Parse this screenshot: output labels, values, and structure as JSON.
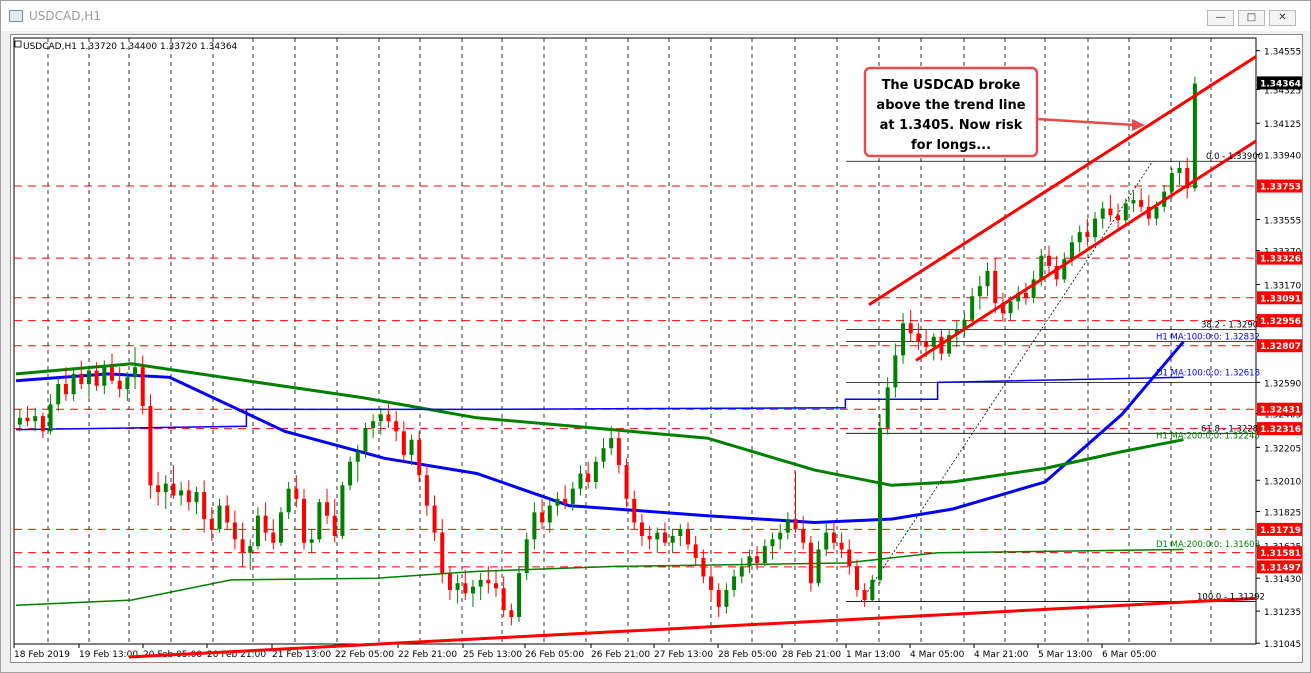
{
  "window": {
    "title": "USDCAD,H1"
  },
  "window_buttons": {
    "minimize": "—",
    "maximize": "□",
    "close": "✕"
  },
  "chart_data": {
    "type": "candlestick",
    "symbol_info": "USDCAD,H1  1.33720 1.34400 1.33720 1.34364",
    "ylim": [
      1.3104,
      1.3463
    ],
    "y_ticks": [
      "1.34555",
      "1.34325",
      "1.34125",
      "1.33940",
      "1.33555",
      "1.33370",
      "1.33170",
      "1.32975",
      "1.32590",
      "1.32405",
      "1.32205",
      "1.32010",
      "1.31825",
      "1.31625",
      "1.31430",
      "1.31235",
      "1.31045"
    ],
    "x_ticks": [
      "18 Feb 2019",
      "19 Feb 13:00",
      "20 Feb 05:00",
      "20 Feb 21:00",
      "21 Feb 13:00",
      "22 Feb 05:00",
      "22 Feb 21:00",
      "25 Feb 13:00",
      "26 Feb 05:00",
      "26 Feb 21:00",
      "27 Feb 13:00",
      "28 Feb 05:00",
      "28 Feb 21:00",
      "1 Mar 13:00",
      "4 Mar 05:00",
      "4 Mar 21:00",
      "5 Mar 13:00",
      "6 Mar 05:00"
    ],
    "price_labels": [
      {
        "value": "1.34364",
        "color": "#000000"
      },
      {
        "value": "1.33753",
        "color": "#ff0000"
      },
      {
        "value": "1.33326",
        "color": "#ff0000"
      },
      {
        "value": "1.33091",
        "color": "#ff0000"
      },
      {
        "value": "1.32956",
        "color": "#ff0000"
      },
      {
        "value": "1.32807",
        "color": "#ff0000"
      },
      {
        "value": "1.32431",
        "color": "#ff0000"
      },
      {
        "value": "1.32316",
        "color": "#ff0000"
      },
      {
        "value": "1.31719",
        "color": "#ff0000"
      },
      {
        "value": "1.31581",
        "color": "#ff0000"
      },
      {
        "value": "1.31497",
        "color": "#ff0000"
      }
    ],
    "level_labels": [
      "0.0 - 1.33900",
      "38.2 - 1.32904",
      "H1 MA:100:0:0: 1.32832",
      "D1 MA:100:0:0: 1.32618",
      "61.8 - 1.32288",
      "H1 MA:200:0:0: 1.32245",
      "D1 MA:200:0:0: 1.31603",
      "100.0 - 1.31292"
    ],
    "annotation": [
      "The USDCAD broke",
      "above the trend line",
      "at 1.3405. Now risk",
      "for longs..."
    ],
    "candles": [
      [
        1.3234,
        1.3243,
        1.323,
        1.3238
      ],
      [
        1.3238,
        1.3245,
        1.3233,
        1.3236
      ],
      [
        1.3236,
        1.3244,
        1.323,
        1.3239
      ],
      [
        1.3239,
        1.3241,
        1.3226,
        1.323
      ],
      [
        1.323,
        1.3252,
        1.3228,
        1.3246
      ],
      [
        1.3246,
        1.3262,
        1.3242,
        1.3258
      ],
      [
        1.3258,
        1.3268,
        1.3248,
        1.3252
      ],
      [
        1.3252,
        1.3266,
        1.3248,
        1.3264
      ],
      [
        1.3264,
        1.3272,
        1.3255,
        1.3258
      ],
      [
        1.3258,
        1.3269,
        1.325,
        1.3266
      ],
      [
        1.3266,
        1.3271,
        1.3254,
        1.3257
      ],
      [
        1.3257,
        1.3272,
        1.3252,
        1.3268
      ],
      [
        1.3268,
        1.3276,
        1.3258,
        1.326
      ],
      [
        1.326,
        1.3268,
        1.325,
        1.3255
      ],
      [
        1.3255,
        1.3265,
        1.3248,
        1.3262
      ],
      [
        1.3262,
        1.328,
        1.3255,
        1.3268
      ],
      [
        1.3268,
        1.3275,
        1.324,
        1.3245
      ],
      [
        1.3245,
        1.3252,
        1.319,
        1.3198
      ],
      [
        1.3198,
        1.3206,
        1.3186,
        1.3194
      ],
      [
        1.3194,
        1.3204,
        1.3184,
        1.3199
      ],
      [
        1.3199,
        1.321,
        1.319,
        1.3192
      ],
      [
        1.3192,
        1.32,
        1.3186,
        1.3195
      ],
      [
        1.3195,
        1.3201,
        1.3183,
        1.3188
      ],
      [
        1.3188,
        1.3197,
        1.3181,
        1.3194
      ],
      [
        1.3194,
        1.3201,
        1.317,
        1.3178
      ],
      [
        1.3178,
        1.3185,
        1.3165,
        1.3172
      ],
      [
        1.3172,
        1.319,
        1.317,
        1.3186
      ],
      [
        1.3186,
        1.3192,
        1.3172,
        1.3176
      ],
      [
        1.3176,
        1.3183,
        1.316,
        1.3166
      ],
      [
        1.3166,
        1.3176,
        1.315,
        1.3158
      ],
      [
        1.3158,
        1.3166,
        1.3148,
        1.3162
      ],
      [
        1.3162,
        1.3185,
        1.316,
        1.318
      ],
      [
        1.318,
        1.3188,
        1.3165,
        1.317
      ],
      [
        1.317,
        1.3178,
        1.316,
        1.3164
      ],
      [
        1.3164,
        1.3185,
        1.3162,
        1.3182
      ],
      [
        1.3182,
        1.32,
        1.3178,
        1.3196
      ],
      [
        1.3196,
        1.3204,
        1.3185,
        1.319
      ],
      [
        1.319,
        1.3196,
        1.316,
        1.3164
      ],
      [
        1.3164,
        1.3172,
        1.3158,
        1.3166
      ],
      [
        1.3166,
        1.319,
        1.3164,
        1.3188
      ],
      [
        1.3188,
        1.3196,
        1.3175,
        1.318
      ],
      [
        1.318,
        1.319,
        1.3164,
        1.3168
      ],
      [
        1.3168,
        1.32,
        1.3166,
        1.3198
      ],
      [
        1.3198,
        1.3215,
        1.3195,
        1.3212
      ],
      [
        1.3212,
        1.3222,
        1.32,
        1.3218
      ],
      [
        1.3218,
        1.3235,
        1.3214,
        1.3232
      ],
      [
        1.3232,
        1.324,
        1.3226,
        1.3236
      ],
      [
        1.3236,
        1.3244,
        1.3228,
        1.324
      ],
      [
        1.324,
        1.3246,
        1.3232,
        1.3236
      ],
      [
        1.3236,
        1.3242,
        1.3224,
        1.323
      ],
      [
        1.323,
        1.3236,
        1.3212,
        1.3216
      ],
      [
        1.3216,
        1.3228,
        1.321,
        1.3225
      ],
      [
        1.3225,
        1.323,
        1.32,
        1.3204
      ],
      [
        1.3204,
        1.321,
        1.318,
        1.3186
      ],
      [
        1.3186,
        1.3192,
        1.3165,
        1.317
      ],
      [
        1.317,
        1.3178,
        1.314,
        1.3146
      ],
      [
        1.3146,
        1.315,
        1.313,
        1.3136
      ],
      [
        1.3136,
        1.3145,
        1.3128,
        1.314
      ],
      [
        1.314,
        1.3148,
        1.313,
        1.3134
      ],
      [
        1.3134,
        1.3142,
        1.3126,
        1.3138
      ],
      [
        1.3138,
        1.3146,
        1.313,
        1.3142
      ],
      [
        1.3142,
        1.315,
        1.3134,
        1.314
      ],
      [
        1.314,
        1.3148,
        1.3132,
        1.3137
      ],
      [
        1.3137,
        1.3144,
        1.312,
        1.3124
      ],
      [
        1.3124,
        1.3128,
        1.3115,
        1.312
      ],
      [
        1.312,
        1.315,
        1.3117,
        1.3146
      ],
      [
        1.3146,
        1.317,
        1.3142,
        1.3166
      ],
      [
        1.3166,
        1.3188,
        1.316,
        1.3182
      ],
      [
        1.3182,
        1.319,
        1.3172,
        1.3176
      ],
      [
        1.3176,
        1.319,
        1.317,
        1.3186
      ],
      [
        1.3186,
        1.3194,
        1.318,
        1.319
      ],
      [
        1.319,
        1.3198,
        1.3184,
        1.3187
      ],
      [
        1.3187,
        1.32,
        1.3183,
        1.3196
      ],
      [
        1.3196,
        1.321,
        1.3192,
        1.3205
      ],
      [
        1.3205,
        1.3212,
        1.3196,
        1.32
      ],
      [
        1.32,
        1.3215,
        1.3196,
        1.3212
      ],
      [
        1.3212,
        1.3226,
        1.3208,
        1.322
      ],
      [
        1.322,
        1.3233,
        1.3216,
        1.3226
      ],
      [
        1.3226,
        1.323,
        1.3205,
        1.321
      ],
      [
        1.321,
        1.3214,
        1.3185,
        1.319
      ],
      [
        1.319,
        1.3195,
        1.3172,
        1.3176
      ],
      [
        1.3176,
        1.3181,
        1.3162,
        1.3168
      ],
      [
        1.3168,
        1.3174,
        1.316,
        1.3166
      ],
      [
        1.3166,
        1.3173,
        1.3158,
        1.317
      ],
      [
        1.317,
        1.3176,
        1.3162,
        1.3164
      ],
      [
        1.3164,
        1.3172,
        1.3158,
        1.3168
      ],
      [
        1.3168,
        1.3175,
        1.3162,
        1.3172
      ],
      [
        1.3172,
        1.3176,
        1.316,
        1.3163
      ],
      [
        1.3163,
        1.3168,
        1.315,
        1.3155
      ],
      [
        1.3155,
        1.316,
        1.314,
        1.3144
      ],
      [
        1.3144,
        1.315,
        1.313,
        1.3136
      ],
      [
        1.3136,
        1.314,
        1.312,
        1.3126
      ],
      [
        1.3126,
        1.314,
        1.3122,
        1.3136
      ],
      [
        1.3136,
        1.3148,
        1.3132,
        1.3144
      ],
      [
        1.3144,
        1.3155,
        1.314,
        1.315
      ],
      [
        1.315,
        1.316,
        1.3146,
        1.3156
      ],
      [
        1.3156,
        1.3162,
        1.3148,
        1.3152
      ],
      [
        1.3152,
        1.3166,
        1.315,
        1.3162
      ],
      [
        1.3162,
        1.317,
        1.3154,
        1.3166
      ],
      [
        1.3166,
        1.3175,
        1.316,
        1.317
      ],
      [
        1.317,
        1.3182,
        1.3166,
        1.3178
      ],
      [
        1.3178,
        1.3206,
        1.317,
        1.3172
      ],
      [
        1.3172,
        1.318,
        1.316,
        1.3164
      ],
      [
        1.3164,
        1.3168,
        1.3135,
        1.314
      ],
      [
        1.314,
        1.3165,
        1.3138,
        1.316
      ],
      [
        1.316,
        1.3176,
        1.3156,
        1.317
      ],
      [
        1.317,
        1.3176,
        1.316,
        1.3164
      ],
      [
        1.3164,
        1.317,
        1.3155,
        1.316
      ],
      [
        1.316,
        1.3166,
        1.3145,
        1.315
      ],
      [
        1.315,
        1.3154,
        1.3132,
        1.3136
      ],
      [
        1.3136,
        1.314,
        1.3126,
        1.313
      ],
      [
        1.313,
        1.3145,
        1.3129,
        1.3142
      ],
      [
        1.3142,
        1.324,
        1.314,
        1.3232
      ],
      [
        1.3232,
        1.3262,
        1.3228,
        1.3256
      ],
      [
        1.3256,
        1.3282,
        1.325,
        1.3275
      ],
      [
        1.3275,
        1.33,
        1.327,
        1.3294
      ],
      [
        1.3294,
        1.3302,
        1.3283,
        1.3288
      ],
      [
        1.3288,
        1.3294,
        1.3278,
        1.3283
      ],
      [
        1.3283,
        1.329,
        1.3274,
        1.328
      ],
      [
        1.328,
        1.3288,
        1.3272,
        1.3286
      ],
      [
        1.3286,
        1.329,
        1.3272,
        1.3276
      ],
      [
        1.3276,
        1.329,
        1.3274,
        1.3287
      ],
      [
        1.3287,
        1.3296,
        1.328,
        1.329
      ],
      [
        1.329,
        1.33,
        1.3286,
        1.3296
      ],
      [
        1.3296,
        1.3315,
        1.3292,
        1.331
      ],
      [
        1.331,
        1.3322,
        1.3302,
        1.3316
      ],
      [
        1.3316,
        1.333,
        1.331,
        1.3325
      ],
      [
        1.3325,
        1.3333,
        1.33,
        1.3306
      ],
      [
        1.3306,
        1.3312,
        1.3295,
        1.33
      ],
      [
        1.33,
        1.331,
        1.3296,
        1.3307
      ],
      [
        1.3307,
        1.3316,
        1.3302,
        1.3312
      ],
      [
        1.3312,
        1.3318,
        1.3305,
        1.3309
      ],
      [
        1.3309,
        1.3325,
        1.3306,
        1.332
      ],
      [
        1.332,
        1.3338,
        1.3316,
        1.3334
      ],
      [
        1.3334,
        1.334,
        1.3322,
        1.3328
      ],
      [
        1.3328,
        1.3334,
        1.3316,
        1.332
      ],
      [
        1.332,
        1.3336,
        1.3318,
        1.3332
      ],
      [
        1.3332,
        1.3346,
        1.3328,
        1.3342
      ],
      [
        1.3342,
        1.3352,
        1.3336,
        1.3348
      ],
      [
        1.3348,
        1.3356,
        1.334,
        1.3345
      ],
      [
        1.3345,
        1.336,
        1.3342,
        1.3356
      ],
      [
        1.3356,
        1.3366,
        1.335,
        1.3362
      ],
      [
        1.3362,
        1.337,
        1.3354,
        1.3358
      ],
      [
        1.3358,
        1.3365,
        1.335,
        1.3355
      ],
      [
        1.3355,
        1.3368,
        1.3352,
        1.3365
      ],
      [
        1.3365,
        1.3372,
        1.336,
        1.3367
      ],
      [
        1.3367,
        1.3374,
        1.336,
        1.3363
      ],
      [
        1.3363,
        1.337,
        1.3352,
        1.3356
      ],
      [
        1.3356,
        1.3366,
        1.3352,
        1.3363
      ],
      [
        1.3363,
        1.3376,
        1.336,
        1.3372
      ],
      [
        1.3372,
        1.3386,
        1.3368,
        1.3383
      ],
      [
        1.3383,
        1.339,
        1.3376,
        1.3386
      ],
      [
        1.3386,
        1.3392,
        1.3368,
        1.3374
      ],
      [
        1.3374,
        1.344,
        1.3372,
        1.3436
      ]
    ],
    "indicators": [
      {
        "name": "H1 MA:100",
        "color": "#0000ff",
        "values": [
          [
            0,
            1.326
          ],
          [
            12,
            1.3264
          ],
          [
            20,
            1.3262
          ],
          [
            35,
            1.323
          ],
          [
            48,
            1.3214
          ],
          [
            60,
            1.3205
          ],
          [
            72,
            1.3186
          ],
          [
            90,
            1.318
          ],
          [
            104,
            1.3176
          ],
          [
            114,
            1.3178
          ],
          [
            122,
            1.3184
          ],
          [
            134,
            1.32
          ],
          [
            144,
            1.324
          ],
          [
            152,
            1.3283
          ]
        ]
      },
      {
        "name": "H1 MA:200",
        "color": "#008000",
        "values": [
          [
            0,
            1.3264
          ],
          [
            15,
            1.327
          ],
          [
            30,
            1.326
          ],
          [
            45,
            1.325
          ],
          [
            60,
            1.3238
          ],
          [
            75,
            1.3232
          ],
          [
            90,
            1.3226
          ],
          [
            104,
            1.3207
          ],
          [
            114,
            1.3198
          ],
          [
            122,
            1.32
          ],
          [
            134,
            1.3208
          ],
          [
            144,
            1.3218
          ],
          [
            152,
            1.3225
          ]
        ]
      },
      {
        "name": "D1 MA:100",
        "color": "#0000ff",
        "values": [
          [
            0,
            1.3231
          ],
          [
            30,
            1.3233
          ],
          [
            30,
            1.3243
          ],
          [
            60,
            1.3243
          ],
          [
            108,
            1.3244
          ],
          [
            108,
            1.3249
          ],
          [
            120,
            1.3249
          ],
          [
            120,
            1.3259
          ],
          [
            152,
            1.3262
          ]
        ]
      },
      {
        "name": "D1 MA:200",
        "color": "#008000",
        "values": [
          [
            0,
            1.3127
          ],
          [
            15,
            1.313
          ],
          [
            28,
            1.3142
          ],
          [
            47,
            1.3143
          ],
          [
            60,
            1.3147
          ],
          [
            78,
            1.315
          ],
          [
            108,
            1.3152
          ],
          [
            120,
            1.3158
          ],
          [
            152,
            1.316
          ]
        ]
      }
    ]
  }
}
